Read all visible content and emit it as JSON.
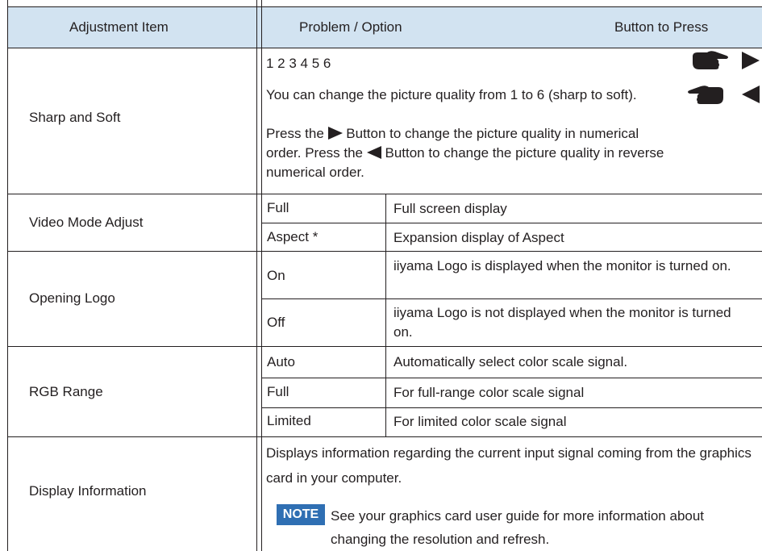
{
  "header": {
    "col1": "Adjustment Item",
    "col2": "Problem / Option",
    "col3": "Button to Press"
  },
  "sharp": {
    "item": "Sharp and Soft",
    "scale": "1 2 3 4 5 6",
    "description": "You can change the picture quality from 1 to 6 (sharp to soft).",
    "press_right_pre": "Press the",
    "press_right_post": "Button to change the picture quality in numerical order. Press the",
    "press_left_post": "Button to change the picture quality in reverse numerical order.",
    "icons": [
      "hand-pointing-right-icon",
      "triangle-right-icon",
      "hand-pointing-left-icon",
      "triangle-left-icon"
    ]
  },
  "video": {
    "item": "Video Mode Adjust",
    "options": [
      {
        "option": "Full",
        "desc": "Full screen display"
      },
      {
        "option": "Aspect *",
        "desc": "Expansion display of Aspect"
      }
    ]
  },
  "logo": {
    "item": "Opening Logo",
    "options": [
      {
        "option": "On",
        "desc": "iiyama Logo is displayed when the monitor is turned on."
      },
      {
        "option": "Off",
        "desc": "iiyama Logo is not displayed when the monitor is turned on."
      }
    ]
  },
  "rgb": {
    "item": "RGB Range",
    "options": [
      {
        "option": "Auto",
        "desc": "Automatically select color scale signal."
      },
      {
        "option": "Full",
        "desc": "For full-range color scale signal"
      },
      {
        "option": "Limited",
        "desc": "For limited color scale signal"
      }
    ]
  },
  "info": {
    "item": "Display Information",
    "description": "Displays information regarding the current input signal coming from the graphics card in your computer.",
    "note_label": "NOTE",
    "note_text": "See your graphics card user guide for more information about changing the resolution and refresh."
  },
  "colors": {
    "header_bg": "#d2e3f1",
    "note_bg": "#2f6fb3",
    "line": "#231f20"
  }
}
